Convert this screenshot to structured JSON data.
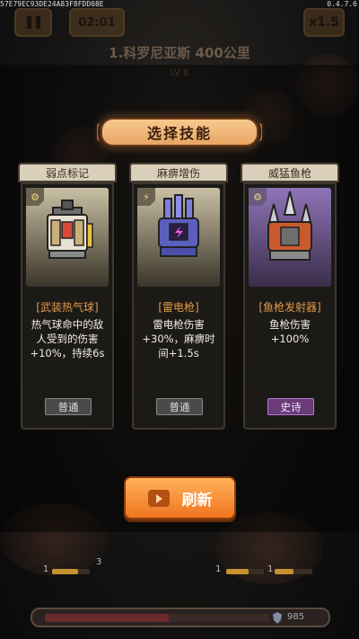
{
  "build_id": "57E79EC93DE24A83F8FDD08E",
  "version": "0.4.7.6",
  "hud": {
    "timer": "02:01",
    "speed": "x1.5",
    "stage_title": "1.科罗尼亚斯 400公里",
    "level": "LV 8"
  },
  "dialog": {
    "title": "选择技能",
    "cards": [
      {
        "tab": "弱点标记",
        "icon": "gear-icon",
        "item_name": "[武装热气球]",
        "description": "热气球命中的敌人受到的伤害+10%，持续6s",
        "rarity": "普通"
      },
      {
        "tab": "麻痹增伤",
        "icon": "lightning-icon",
        "item_name": "[雷电枪]",
        "description": "雷电枪伤害+30%，麻痹时间+1.5s",
        "rarity": "普通"
      },
      {
        "tab": "威猛鱼枪",
        "icon": "gear-icon",
        "item_name": "[鱼枪发射器]",
        "description": "鱼枪伤害+100%",
        "rarity": "史诗"
      }
    ],
    "refresh_label": "刷新"
  },
  "bottom": {
    "slot_values": [
      "1",
      "3",
      "1",
      "1"
    ],
    "hp_value": "985",
    "hp_fraction": 0.55
  },
  "colors": {
    "accent_orange": "#f0741e",
    "epic_purple": "#6a3b78",
    "item_name": "#e39a4a"
  }
}
